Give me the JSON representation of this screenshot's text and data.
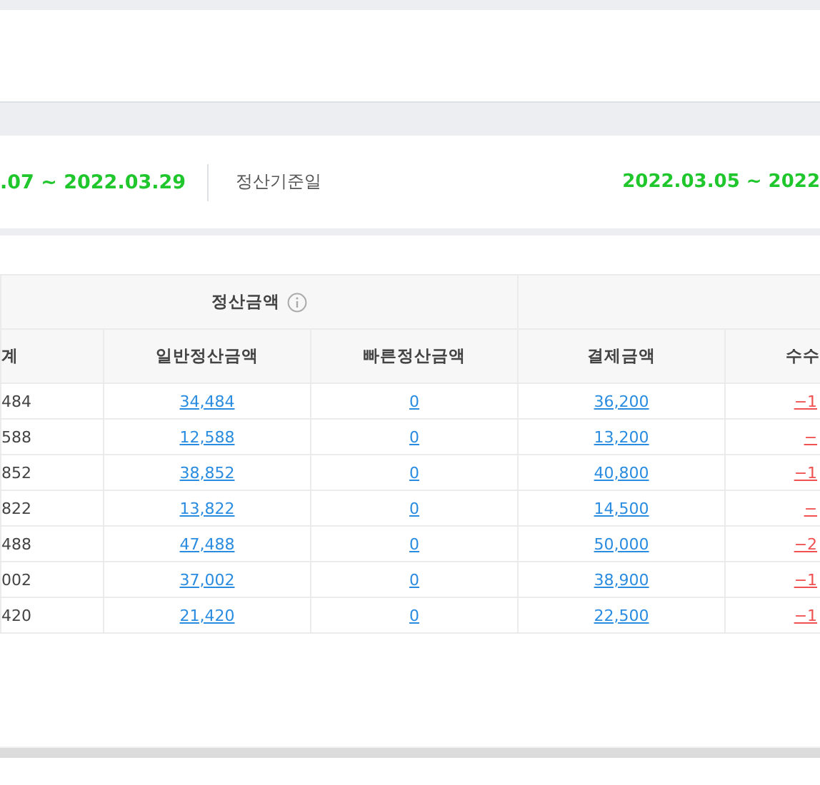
{
  "period": {
    "range_left": ".07 ~ 2022.03.29",
    "label": "정산기준일",
    "range_right": "2022.03.05 ~ 2022"
  },
  "table": {
    "group_header": "정산금액",
    "columns": [
      {
        "label": "계",
        "kind": "plain"
      },
      {
        "label": "일반정산금액",
        "kind": "link"
      },
      {
        "label": "빠른정산금액",
        "kind": "link"
      },
      {
        "label": "결제금액",
        "kind": "link"
      },
      {
        "label": "수수",
        "kind": "negative"
      }
    ],
    "rows": [
      [
        "484",
        "34,484",
        "0",
        "36,200",
        "−1"
      ],
      [
        "588",
        "12,588",
        "0",
        "13,200",
        "−"
      ],
      [
        "852",
        "38,852",
        "0",
        "40,800",
        "−1"
      ],
      [
        "822",
        "13,822",
        "0",
        "14,500",
        "−"
      ],
      [
        "488",
        "47,488",
        "0",
        "50,000",
        "−2"
      ],
      [
        "002",
        "37,002",
        "0",
        "38,900",
        "−1"
      ],
      [
        "420",
        "21,420",
        "0",
        "22,500",
        "−1"
      ]
    ]
  }
}
